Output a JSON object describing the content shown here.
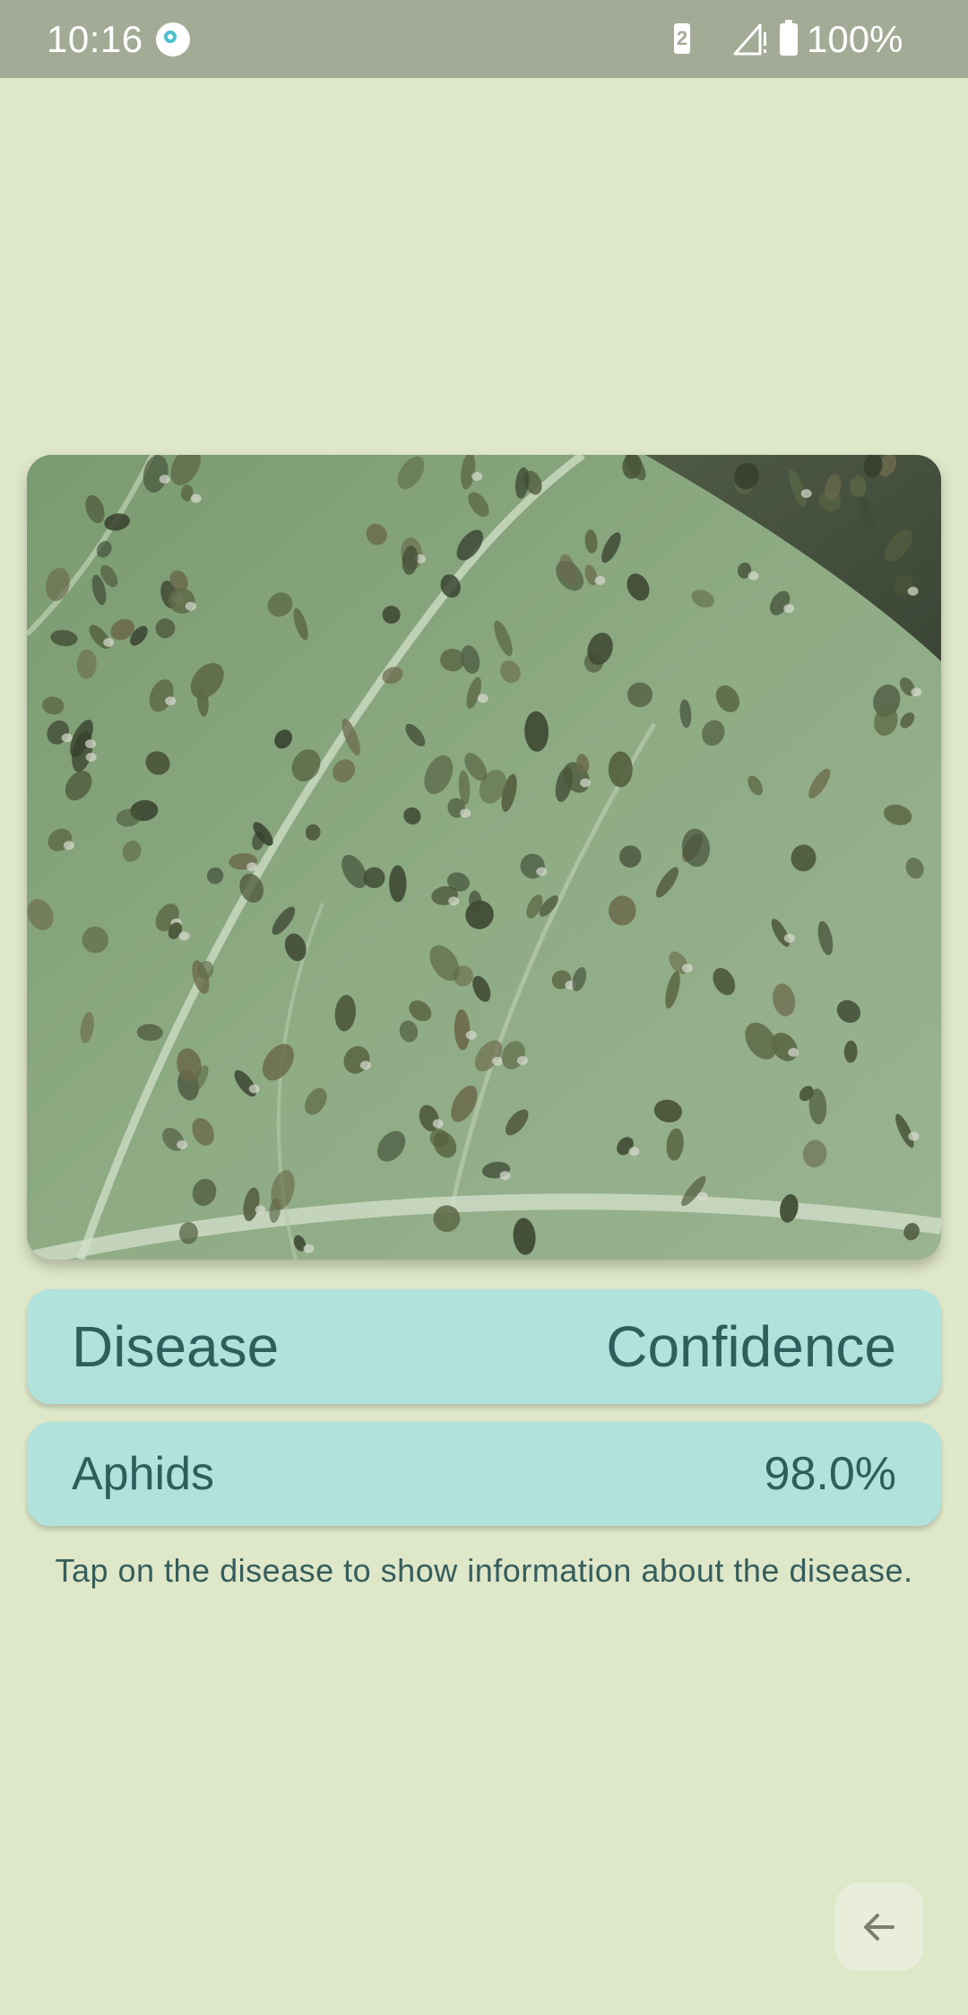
{
  "status_bar": {
    "time": "10:16",
    "sim_slot": "2",
    "battery_percent": "100%",
    "icons": [
      "app-notification-icon",
      "sim-icon",
      "signal-icon",
      "battery-charging-icon"
    ]
  },
  "image_card": {
    "description_icon": "leaf-aphids-photo"
  },
  "table_header": {
    "left": "Disease",
    "right": "Confidence"
  },
  "result": {
    "disease": "Aphids",
    "confidence": "98.0%"
  },
  "hint": "Tap on the disease to show information about the disease.",
  "back_button": {
    "icon": "arrow-left-icon"
  },
  "colors": {
    "background": "#dfe7c9",
    "status_bar": "#a3ab96",
    "row_card": "#b1e2dc",
    "text": "#2f5f5c"
  }
}
